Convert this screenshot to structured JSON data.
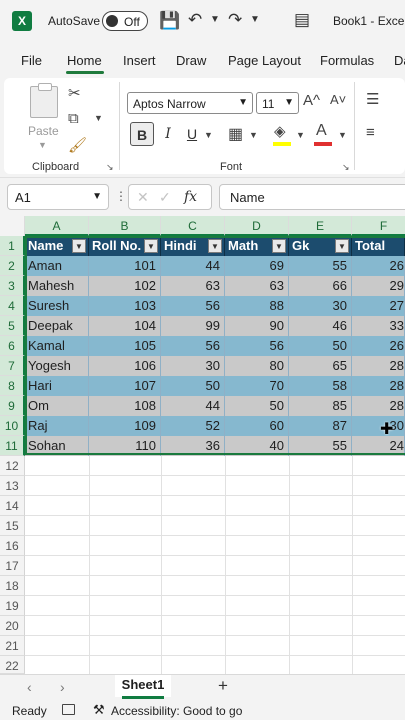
{
  "titlebar": {
    "logo": "X",
    "autosave_label": "AutoSave",
    "autosave_state": "Off",
    "title": "Book1 - Exce",
    "icons": [
      "excel-logo-icon",
      "save-icon",
      "undo-icon",
      "redo-icon",
      "customize-icon"
    ]
  },
  "tabs": [
    "File",
    "Home",
    "Insert",
    "Draw",
    "Page Layout",
    "Formulas",
    "Da"
  ],
  "active_tab": "Home",
  "ribbon": {
    "clipboard": {
      "paste_label": "Paste",
      "group_label": "Clipboard"
    },
    "font": {
      "font_name": "Aptos Narrow",
      "font_size": "11",
      "bold": "B",
      "italic": "I",
      "underline": "U",
      "group_label": "Font",
      "grow_icon": "A^",
      "shrink_icon": "A˅",
      "fill_color": "#ffff00",
      "font_color": "#e03030"
    }
  },
  "formula_bar": {
    "name_box": "A1",
    "fx": "fx",
    "value": "Name"
  },
  "columns": [
    "A",
    "B",
    "C",
    "D",
    "E",
    "F"
  ],
  "rows": [
    "1",
    "2",
    "3",
    "4",
    "5",
    "6",
    "7",
    "8",
    "9",
    "10",
    "11",
    "12",
    "13",
    "14",
    "15",
    "16",
    "17",
    "18",
    "19",
    "20",
    "21",
    "22"
  ],
  "table": {
    "headers": [
      "Name",
      "Roll No.",
      "Hindi",
      "Math",
      "Gk",
      "Total"
    ],
    "rows": [
      [
        "Aman",
        "101",
        "44",
        "69",
        "55",
        "26"
      ],
      [
        "Mahesh",
        "102",
        "63",
        "63",
        "66",
        "29"
      ],
      [
        "Suresh",
        "103",
        "56",
        "88",
        "30",
        "27"
      ],
      [
        "Deepak",
        "104",
        "99",
        "90",
        "46",
        "33"
      ],
      [
        "Kamal",
        "105",
        "56",
        "56",
        "50",
        "26"
      ],
      [
        "Yogesh",
        "106",
        "30",
        "80",
        "65",
        "28"
      ],
      [
        "Hari",
        "107",
        "50",
        "70",
        "58",
        "28"
      ],
      [
        "Om",
        "108",
        "44",
        "50",
        "85",
        "28"
      ],
      [
        "Raj",
        "109",
        "52",
        "60",
        "87",
        "30"
      ],
      [
        "Sohan",
        "110",
        "36",
        "40",
        "55",
        "24"
      ]
    ],
    "header_color": "#1c4c6e",
    "band_colors": [
      "#86b8cf",
      "#c9c9c9"
    ]
  },
  "sheets": {
    "active": "Sheet1",
    "add_label": "+"
  },
  "status": {
    "ready": "Ready",
    "accessibility": "Accessibility: Good to go"
  }
}
